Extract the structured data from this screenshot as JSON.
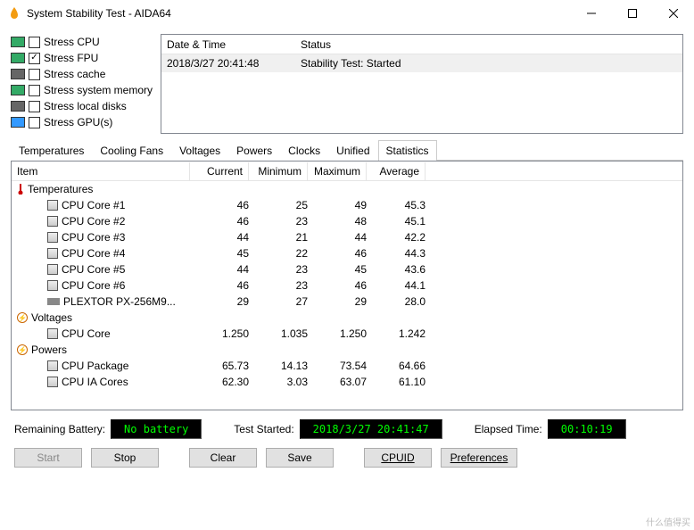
{
  "window": {
    "title": "System Stability Test - AIDA64"
  },
  "stress": {
    "items": [
      {
        "label": "Stress CPU",
        "checked": false
      },
      {
        "label": "Stress FPU",
        "checked": true
      },
      {
        "label": "Stress cache",
        "checked": false
      },
      {
        "label": "Stress system memory",
        "checked": false
      },
      {
        "label": "Stress local disks",
        "checked": false
      },
      {
        "label": "Stress GPU(s)",
        "checked": false
      }
    ]
  },
  "log": {
    "header_date": "Date & Time",
    "header_status": "Status",
    "rows": [
      {
        "date": "2018/3/27 20:41:48",
        "status": "Stability Test: Started"
      }
    ]
  },
  "tabs": [
    "Temperatures",
    "Cooling Fans",
    "Voltages",
    "Powers",
    "Clocks",
    "Unified",
    "Statistics"
  ],
  "active_tab": "Statistics",
  "stats": {
    "headers": {
      "item": "Item",
      "current": "Current",
      "minimum": "Minimum",
      "maximum": "Maximum",
      "average": "Average"
    },
    "groups": [
      {
        "name": "Temperatures",
        "icon": "therm",
        "rows": [
          {
            "icon": "chip",
            "name": "CPU Core #1",
            "cur": "46",
            "min": "25",
            "max": "49",
            "avg": "45.3"
          },
          {
            "icon": "chip",
            "name": "CPU Core #2",
            "cur": "46",
            "min": "23",
            "max": "48",
            "avg": "45.1"
          },
          {
            "icon": "chip",
            "name": "CPU Core #3",
            "cur": "44",
            "min": "21",
            "max": "44",
            "avg": "42.2"
          },
          {
            "icon": "chip",
            "name": "CPU Core #4",
            "cur": "45",
            "min": "22",
            "max": "46",
            "avg": "44.3"
          },
          {
            "icon": "chip",
            "name": "CPU Core #5",
            "cur": "44",
            "min": "23",
            "max": "45",
            "avg": "43.6"
          },
          {
            "icon": "chip",
            "name": "CPU Core #6",
            "cur": "46",
            "min": "23",
            "max": "46",
            "avg": "44.1"
          },
          {
            "icon": "hdd",
            "name": "PLEXTOR PX-256M9...",
            "cur": "29",
            "min": "27",
            "max": "29",
            "avg": "28.0"
          }
        ]
      },
      {
        "name": "Voltages",
        "icon": "volt",
        "rows": [
          {
            "icon": "chip",
            "name": "CPU Core",
            "cur": "1.250",
            "min": "1.035",
            "max": "1.250",
            "avg": "1.242"
          }
        ]
      },
      {
        "name": "Powers",
        "icon": "pow",
        "rows": [
          {
            "icon": "chip",
            "name": "CPU Package",
            "cur": "65.73",
            "min": "14.13",
            "max": "73.54",
            "avg": "64.66"
          },
          {
            "icon": "chip",
            "name": "CPU IA Cores",
            "cur": "62.30",
            "min": "3.03",
            "max": "63.07",
            "avg": "61.10"
          }
        ]
      }
    ]
  },
  "status": {
    "battery_label": "Remaining Battery:",
    "battery_value": "No battery",
    "started_label": "Test Started:",
    "started_value": "2018/3/27 20:41:47",
    "elapsed_label": "Elapsed Time:",
    "elapsed_value": "00:10:19"
  },
  "buttons": {
    "start": "Start",
    "stop": "Stop",
    "clear": "Clear",
    "save": "Save",
    "cpuid": "CPUID",
    "prefs": "Preferences"
  },
  "watermark": "什么值得买"
}
